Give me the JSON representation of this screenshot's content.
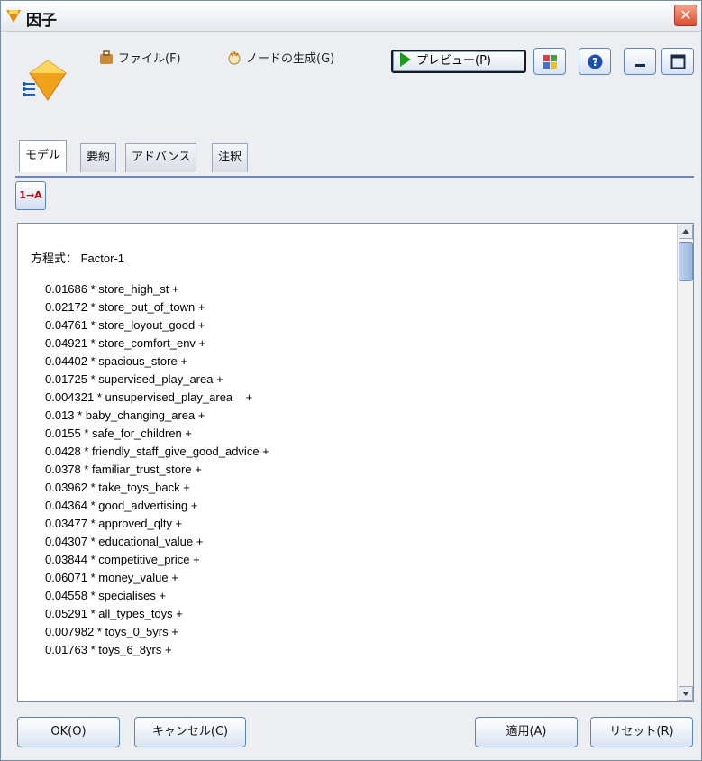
{
  "window": {
    "title": "因子",
    "close_label": "✕"
  },
  "toolbar": {
    "file_label": "ファイル(F)",
    "generate_label": "ノードの生成(G)",
    "preview_label": "プレビュー(P)"
  },
  "tabs": [
    {
      "label": "モデル"
    },
    {
      "label": "要約"
    },
    {
      "label": "アドバンス"
    },
    {
      "label": "注釈"
    }
  ],
  "model": {
    "sort_label": "1→A",
    "equation_label": "方程式： Factor-1",
    "terms": [
      "0.01686 * store_high_st +",
      "0.02172 * store_out_of_town +",
      "0.04761 * store_loyout_good +",
      "0.04921 * store_comfort_env +",
      "0.04402 * spacious_store +",
      "0.01725 * supervised_play_area +",
      "0.004321 * unsupervised_play_area    +",
      "0.013 * baby_changing_area +",
      "0.0155 * safe_for_children +",
      "0.0428 * friendly_staff_give_good_advice +",
      "0.0378 * familiar_trust_store +",
      "0.03962 * take_toys_back +",
      "0.04364 * good_advertising +",
      "0.03477 * approved_qlty +",
      "0.04307 * educational_value +",
      "0.03844 * competitive_price +",
      "0.06071 * money_value +",
      "0.04558 * specialises +",
      "0.05291 * all_types_toys +",
      "0.007982 * toys_0_5yrs +",
      "0.01763 * toys_6_8yrs +"
    ]
  },
  "footer": {
    "ok_label": "OK(O)",
    "cancel_label": "キャンセル(C)",
    "apply_label": "適用(A)",
    "reset_label": "リセット(R)"
  },
  "colors": {
    "accent": "#5c84c0",
    "title_icon": "#e38a10",
    "close": "#d84f2f"
  }
}
